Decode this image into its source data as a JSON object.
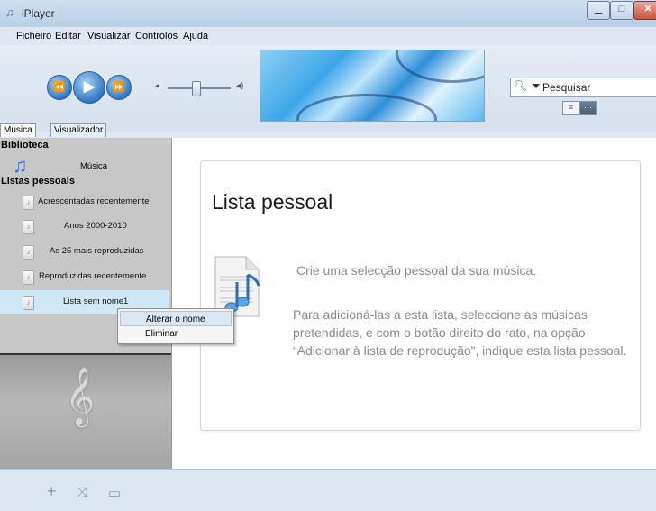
{
  "window": {
    "title": "iPlayer",
    "controls": {
      "minimize": "▁",
      "maximize": "□",
      "close": "✕"
    }
  },
  "menu": [
    "Ficheiro",
    "Editar",
    "Visualizar",
    "Controlos",
    "Ajuda"
  ],
  "toolbar": {
    "search_placeholder": "Pesquisar",
    "transport": {
      "previous": "⏪",
      "play": "▶",
      "next": "⏩"
    },
    "volume_level": 0.45,
    "view_buttons": [
      "list-view-icon",
      "grid-view-icon"
    ]
  },
  "tabs": [
    "Musica",
    "Visualizador"
  ],
  "sidebar": {
    "library_title": "Biblioteca",
    "library_item": "Música",
    "playlists_title": "Listas pessoais",
    "playlists": [
      "Acrescentadas recentemente",
      "Anos 2000-2010",
      "As 25 mais reproduzidas",
      "Reproduzidas recentemente",
      "Lista sem nome1"
    ],
    "selected_index": 4
  },
  "main": {
    "title": "Lista pessoal",
    "line1": "Crie uma selecção pessoal da sua música.",
    "paragraph": "Para adicioná-las a esta lista, seleccione as músicas pretendidas, e com o botão direito do rato, na opção “Adicionar à lista de reprodução”, indique esta lista pessoal."
  },
  "context_menu": {
    "items": [
      "Alterar o nome",
      "Eliminar"
    ],
    "highlighted_index": 0
  },
  "bottom_icons": [
    "add-icon",
    "shuffle-icon",
    "repeat-icon"
  ],
  "colors": {
    "accent": "#2f78c4",
    "highlight": "#cfe8f7",
    "context_highlight": "#dbe7f5"
  }
}
